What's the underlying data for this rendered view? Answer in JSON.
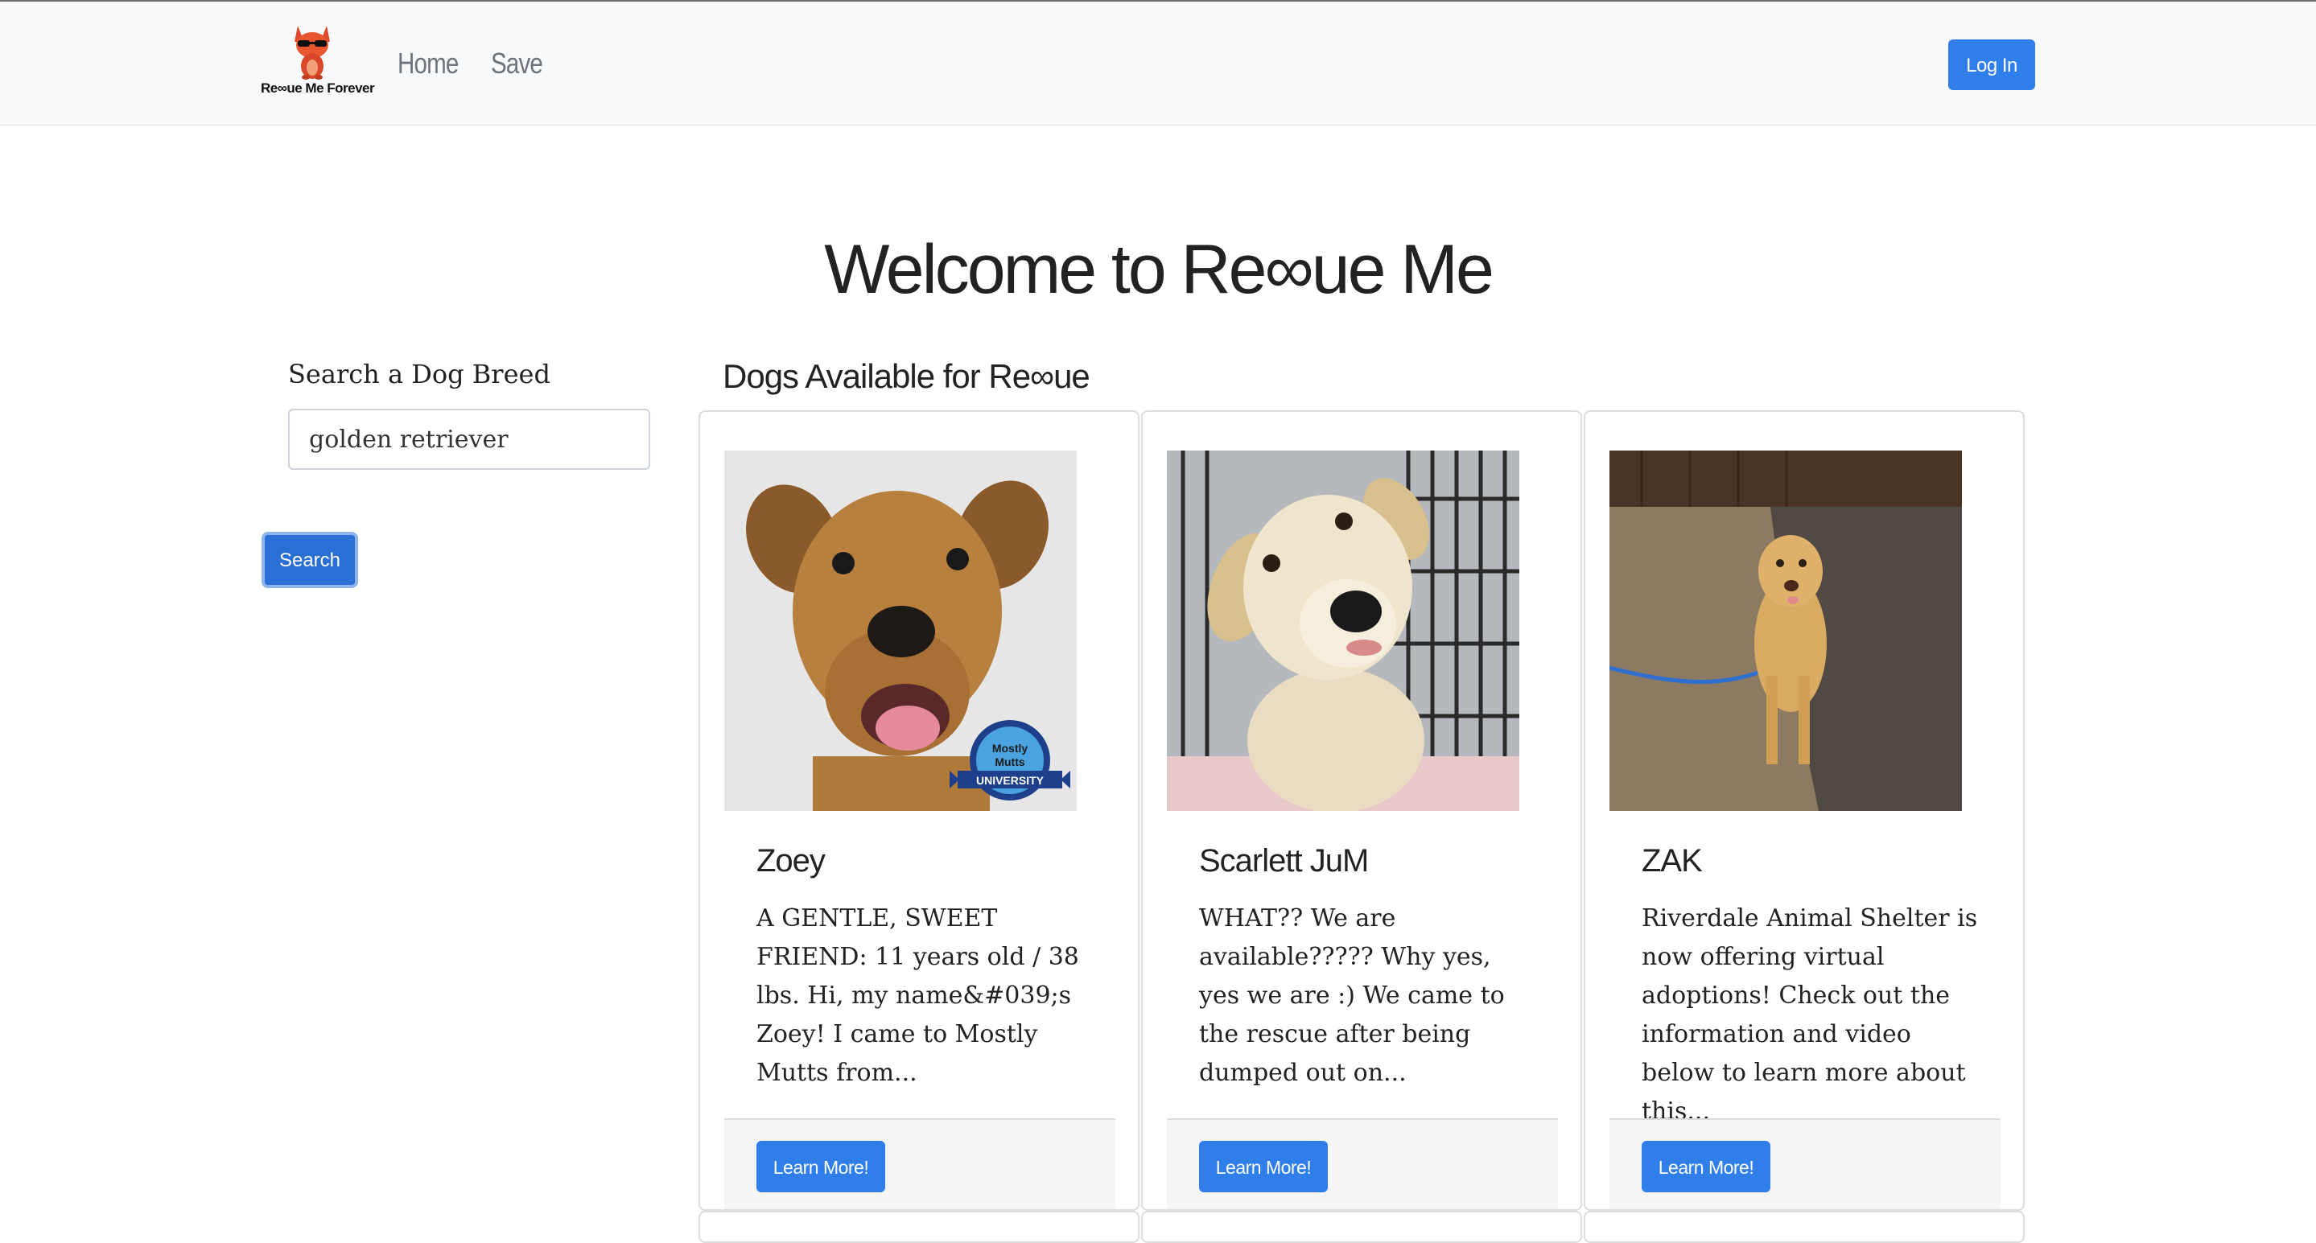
{
  "navbar": {
    "logo_text": "Re∞ue Me Forever",
    "links": [
      {
        "label": "Home"
      },
      {
        "label": "Save"
      }
    ],
    "login_label": "Log In"
  },
  "main": {
    "title": "Welcome to Re∞ue Me"
  },
  "search": {
    "label": "Search a Dog Breed",
    "value": "golden retriever",
    "button_label": "Search"
  },
  "results": {
    "title": "Dogs Available for Re∞ue",
    "cards": [
      {
        "name": "Zoey",
        "description": "A GENTLE, SWEET FRIEND: 11 years old / 38 lbs. Hi, my name&#039;s Zoey! I came to Mostly Mutts from...",
        "badge_lines": [
          "Mostly",
          "Mutts",
          "UNIVERSITY"
        ],
        "button_label": "Learn More!"
      },
      {
        "name": "Scarlett JuM",
        "description": "WHAT?? We are available????? Why yes, yes we are :) We came to the rescue after being dumped out on...",
        "button_label": "Learn More!"
      },
      {
        "name": "ZAK",
        "description": "Riverdale Animal Shelter is now offering virtual adoptions! Check out the information and video below to learn more about this...",
        "button_label": "Learn More!"
      }
    ]
  },
  "colors": {
    "primary": "#2f7eea",
    "navbar_bg": "#f8f9fa",
    "nav_link": "#6c757d"
  }
}
